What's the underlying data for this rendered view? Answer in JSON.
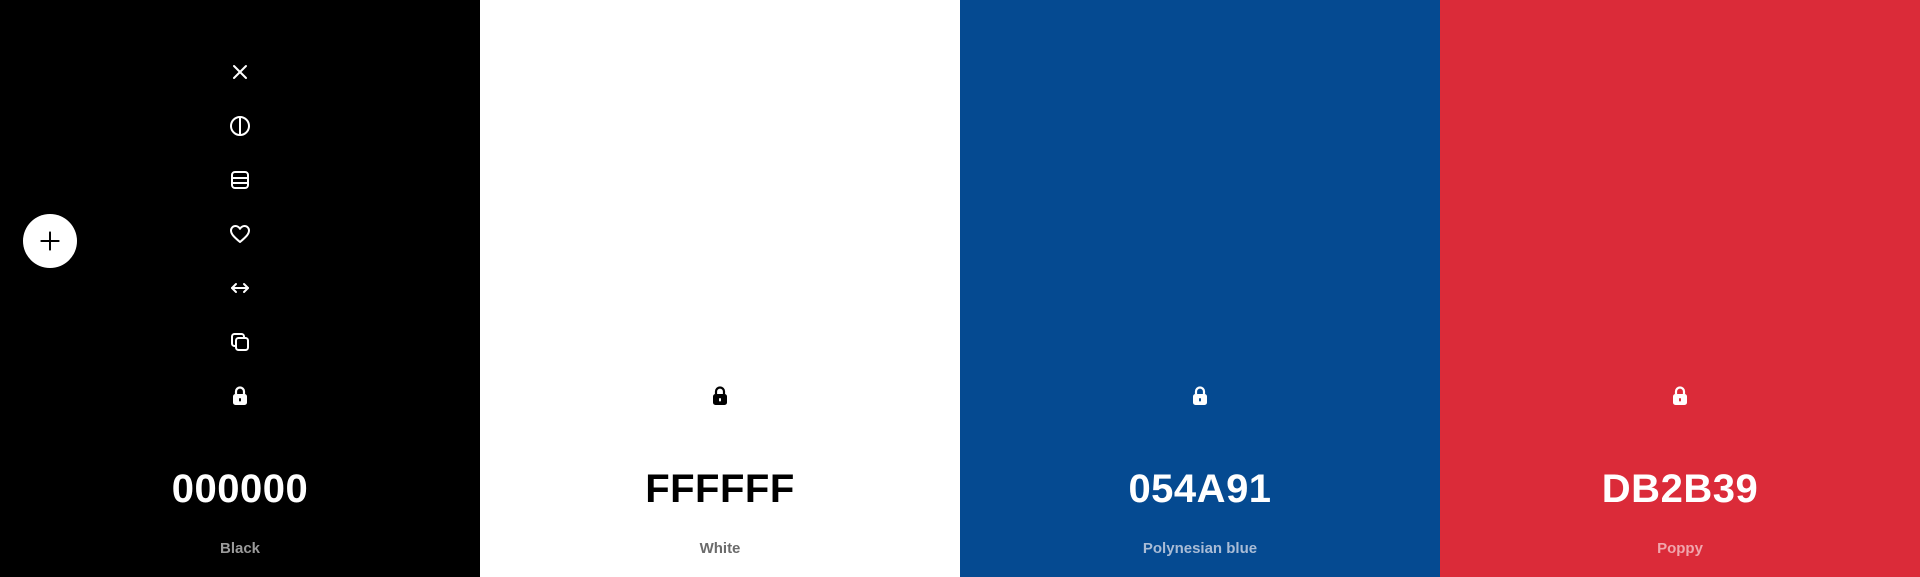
{
  "palette": {
    "colors": [
      {
        "hex": "000000",
        "name": "Black",
        "background": "#000000"
      },
      {
        "hex": "FFFFFF",
        "name": "White",
        "background": "#FFFFFF"
      },
      {
        "hex": "054A91",
        "name": "Polynesian blue",
        "background": "#054A91"
      },
      {
        "hex": "DB2B39",
        "name": "Poppy",
        "background": "#DB2B39"
      }
    ]
  },
  "toolbar_icons": [
    "close-icon",
    "contrast-icon",
    "shades-icon",
    "heart-icon",
    "drag-icon",
    "copy-icon",
    "lock-icon"
  ],
  "add_button_icon": "plus-icon"
}
